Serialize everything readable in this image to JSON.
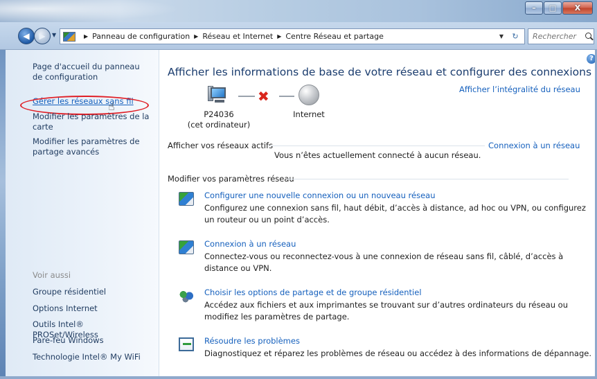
{
  "window": {
    "controls": {
      "minimize": "–",
      "maximize": "□",
      "close": "X"
    }
  },
  "navigation": {
    "breadcrumbs": [
      "Panneau de configuration",
      "Réseau et Internet",
      "Centre Réseau et partage"
    ],
    "search_placeholder": "Rechercher",
    "refresh_glyph": "↻"
  },
  "sidebar": {
    "links": [
      "Page d'accueil du panneau de configuration",
      "Gérer les réseaux sans fil",
      "Modifier les paramètres de la carte",
      "Modifier les paramètres de partage avancés"
    ],
    "see_also_label": "Voir aussi",
    "see_also": [
      "Groupe résidentiel",
      "Options Internet",
      "Outils Intel® PROSet/Wireless",
      "Pare-feu Windows",
      "Technologie Intel® My WiFi"
    ]
  },
  "main": {
    "title": "Afficher les informations de base de votre réseau et configurer des connexions",
    "full_map_link": "Afficher l’intégralité du réseau",
    "computer_name": "P24036",
    "computer_sub": "(cet ordinateur)",
    "internet_label": "Internet",
    "active_networks_label": "Afficher vos réseaux actifs",
    "connect_link": "Connexion à un réseau",
    "not_connected": "Vous n’êtes actuellement connecté à aucun réseau.",
    "change_settings_label": "Modifier vos paramètres réseau",
    "help_glyph": "?",
    "tasks": [
      {
        "icon": "new-connection-icon",
        "link": "Configurer une nouvelle connexion ou un nouveau réseau",
        "desc": "Configurez une connexion sans fil, haut débit, d’accès à distance, ad hoc ou VPN, ou configurez un routeur ou un point d’accès."
      },
      {
        "icon": "connect-network-icon",
        "link": "Connexion à un réseau",
        "desc": "Connectez-vous ou reconnectez-vous à une connexion de réseau sans fil, câblé, d’accès à distance ou VPN."
      },
      {
        "icon": "homegroup-sharing-icon",
        "link": "Choisir les options de partage et de groupe résidentiel",
        "desc": "Accédez aux fichiers et aux imprimantes se trouvant sur d’autres ordinateurs du réseau ou modifiez les paramètres de partage."
      },
      {
        "icon": "troubleshoot-icon",
        "link": "Résoudre les problèmes",
        "desc": "Diagnostiquez et réparez les problèmes de réseau ou accédez à des informations de dépannage."
      }
    ]
  },
  "colors": {
    "link": "#1560bd",
    "title": "#1a3c6e",
    "highlight": "#e01f26",
    "error_x": "#d9261c"
  }
}
